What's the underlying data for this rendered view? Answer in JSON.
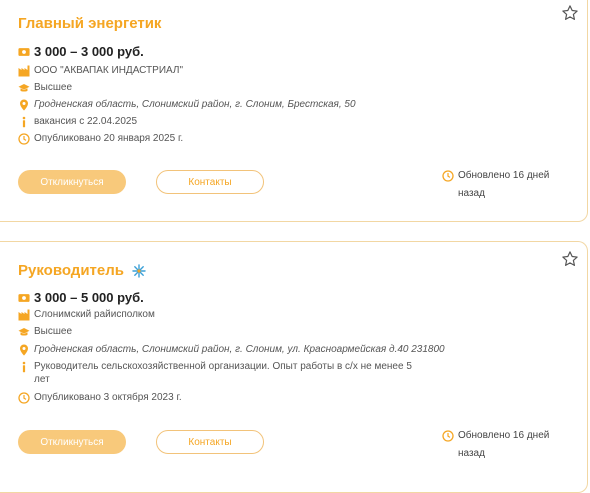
{
  "cards": [
    {
      "title": "Главный энергетик",
      "salary": "3 000 – 3 000 руб.",
      "company": "ООО \"АКВАПАК ИНДАСТРИАЛ\"",
      "education": "Высшее",
      "address": "Гродненская область, Слонимский район, г. Слоним, Брестская, 50",
      "info": "вакансия с 22.04.2025",
      "published": "Опубликовано 20 января 2025 г.",
      "respond_label": "Откликнуться",
      "contacts_label": "Контакты",
      "updated_line1": "Обновлено 16 дней",
      "updated_line2": "назад"
    },
    {
      "title": "Руководитель",
      "salary": "3 000 – 5 000 руб.",
      "company": "Слонимский райисполком",
      "education": "Высшее",
      "address": "Гродненская область, Слонимский район, г. Слоним, ул. Красноармейская д.40 231800",
      "info": "Руководитель сельскохозяйственной организации. Опыт работы в с/х не менее 5 лет",
      "published": "Опубликовано 3 октября 2023 г.",
      "respond_label": "Откликнуться",
      "contacts_label": "Контакты",
      "updated_line1": "Обновлено 16 дней",
      "updated_line2": "назад"
    }
  ],
  "colors": {
    "accent": "#f5a623",
    "button_fill": "#f8c97b",
    "border": "#f2d7a3",
    "badge": "#3aa0d8"
  },
  "icons": {
    "salary": "money-icon",
    "company": "factory-icon",
    "education": "graduation-cap-icon",
    "address": "location-pin-icon",
    "info": "info-icon",
    "published": "clock-icon",
    "favorite": "star-icon",
    "featured": "sparkle-icon"
  }
}
